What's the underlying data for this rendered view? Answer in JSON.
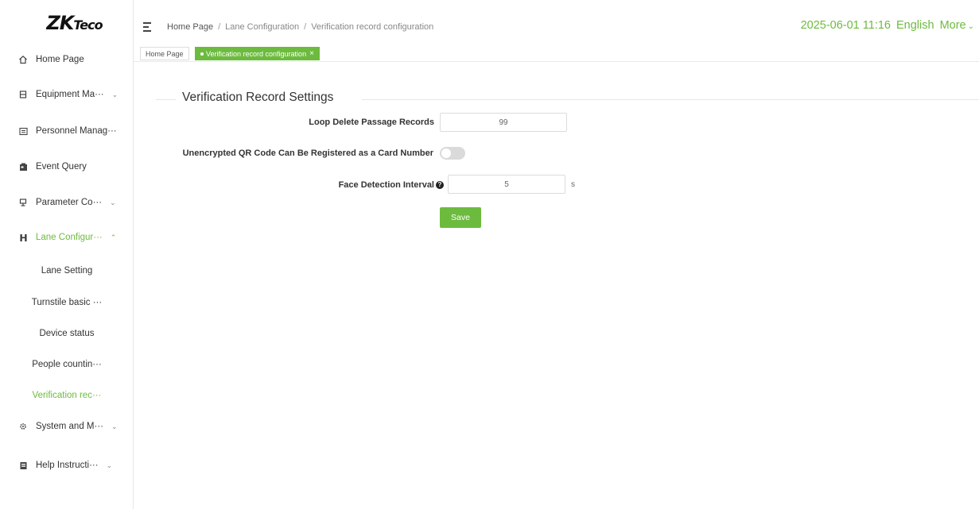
{
  "app": {
    "logo_main": "ZK",
    "logo_sub": "Teco"
  },
  "sidebar": {
    "items": [
      {
        "label": "Home Page",
        "icon": "home-icon"
      },
      {
        "label": "Equipment Ma···",
        "icon": "equipment-icon"
      },
      {
        "label": "Personnel Manag···",
        "icon": "personnel-icon"
      },
      {
        "label": "Event Query",
        "icon": "event-query-icon"
      },
      {
        "label": "Parameter Co···",
        "icon": "parameter-icon"
      },
      {
        "label": "Lane Configur···",
        "icon": "lane-icon"
      },
      {
        "label": "System and M···",
        "icon": "system-icon"
      },
      {
        "label": "Help Instructi···",
        "icon": "help-icon"
      }
    ],
    "sub_items": [
      {
        "label": "Lane Setting"
      },
      {
        "label": "Turnstile basic ···"
      },
      {
        "label": "Device status"
      },
      {
        "label": "People countin···"
      },
      {
        "label": "Verification rec···"
      }
    ]
  },
  "header": {
    "breadcrumb": [
      "Home Page",
      "Lane Configuration",
      "Verification record configuration"
    ],
    "breadcrumb_sep": "/",
    "datetime": "2025-06-01 11:16",
    "language": "English",
    "more": "More"
  },
  "tabs": [
    {
      "label": "Home Page"
    },
    {
      "label": "Verification record configuration",
      "close": "×"
    }
  ],
  "form": {
    "section_title": "Verification Record Settings",
    "loop_delete_label": "Loop Delete Passage Records",
    "loop_delete_value": "99",
    "qr_label": "Unencrypted QR Code Can Be Registered as a Card Number",
    "qr_enabled": false,
    "face_interval_label": "Face Detection Interval",
    "face_interval_value": "5",
    "face_interval_unit": "s",
    "save_label": "Save"
  },
  "colors": {
    "accent": "#6dbb3e"
  }
}
